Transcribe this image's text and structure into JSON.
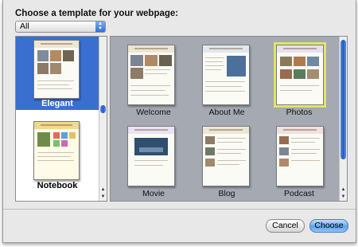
{
  "dialog": {
    "prompt": "Choose a template for your webpage:",
    "filter": {
      "selected": "All"
    }
  },
  "themes": [
    {
      "label": "Elegant",
      "selected": true
    },
    {
      "label": "Notebook",
      "selected": false
    }
  ],
  "templates": [
    {
      "label": "Welcome",
      "selected": false
    },
    {
      "label": "About Me",
      "selected": false
    },
    {
      "label": "Photos",
      "selected": true
    },
    {
      "label": "Movie",
      "selected": false
    },
    {
      "label": "Blog",
      "selected": false
    },
    {
      "label": "Podcast",
      "selected": false
    }
  ],
  "buttons": {
    "cancel": "Cancel",
    "choose": "Choose"
  },
  "colors": {
    "selection": "#3a6fd0",
    "grid_background": "#a4a9b2",
    "selected_template_outline": "#dfe46a"
  }
}
